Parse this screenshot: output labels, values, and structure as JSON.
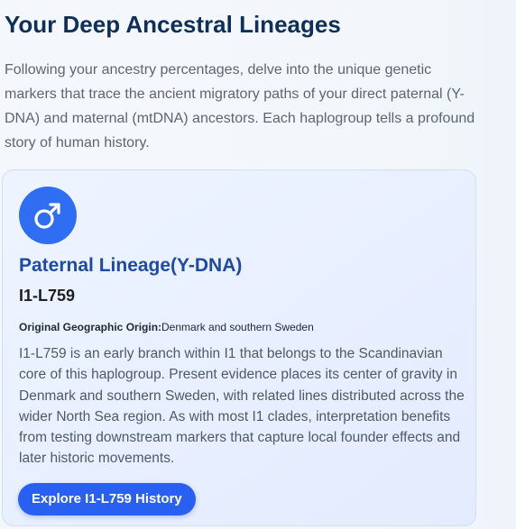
{
  "page": {
    "title": "Your Deep Ancestral Lineages",
    "intro": "Following your ancestry percentages, delve into the unique genetic markers that trace the ancient migratory paths of your direct paternal (Y-DNA) and maternal (mtDNA) ancestors. Each haplogroup tells a profound story of human history."
  },
  "card": {
    "icon": "male-symbol-icon",
    "lineage_title": "Paternal Lineage(Y-DNA)",
    "haplogroup": "I1-L759",
    "origin_label": "Original Geographic Origin:",
    "origin_value": "Denmark and southern Sweden",
    "description": "I1-L759 is an early branch within I1 that belongs to the Scandinavian core of this haplogroup. Present evidence places its center of gravity in Denmark and southern Sweden, with related lines distributed across the wider North Sea region. As with most I1 clades, interpretation benefits from testing downstream markers that capture local founder effects and later historic movements.",
    "button_label": "Explore I1-L759 History"
  },
  "colors": {
    "heading": "#0f2f57",
    "accent": "#2f6df2",
    "button": "#2a60f2",
    "lineage_title": "#1f4aa3",
    "card_background": "#e8efff"
  }
}
